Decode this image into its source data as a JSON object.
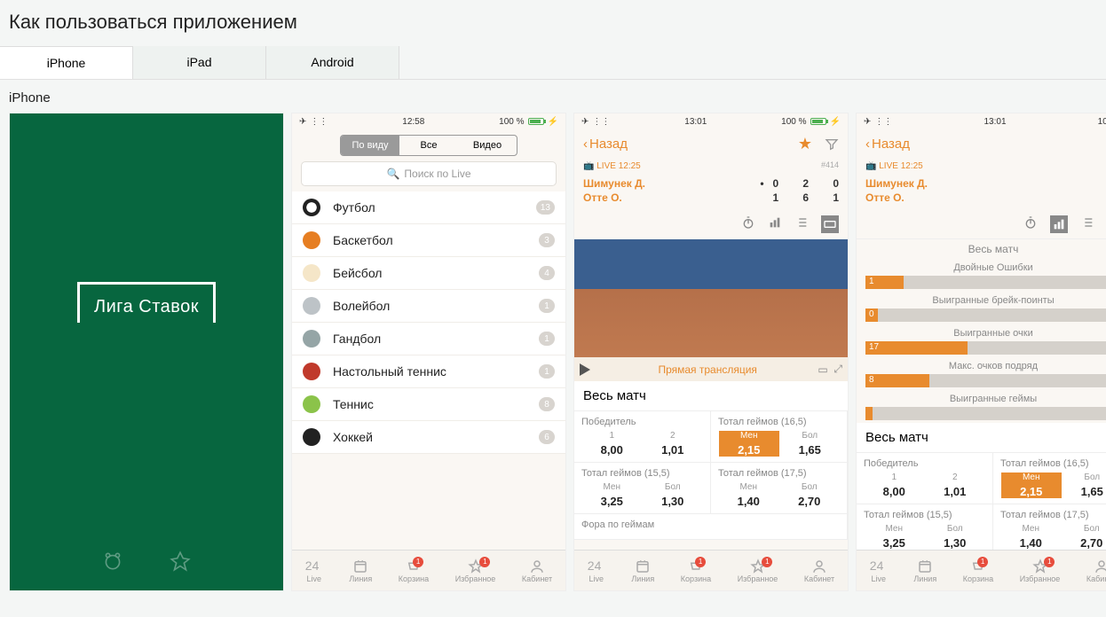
{
  "page": {
    "title": "Как пользоваться приложением",
    "sub": "iPhone"
  },
  "tabs": [
    {
      "label": "iPhone"
    },
    {
      "label": "iPad"
    },
    {
      "label": "Android"
    }
  ],
  "shot1": {
    "logo": "Лига Ставок"
  },
  "sbar": {
    "time2": "12:58",
    "time3": "13:01",
    "time4": "13:01",
    "batt": "100 %"
  },
  "seg": {
    "a": "По виду",
    "b": "Все",
    "c": "Видео"
  },
  "search": {
    "placeholder": "Поиск по Live"
  },
  "sports": [
    {
      "name": "Футбол",
      "count": "13",
      "color": "#222",
      "bg": "radial-gradient(circle,#fff 40%,#222 42%)"
    },
    {
      "name": "Баскетбол",
      "count": "3",
      "bg": "#e67e22"
    },
    {
      "name": "Бейсбол",
      "count": "4",
      "bg": "#f5e6c8"
    },
    {
      "name": "Волейбол",
      "count": "1",
      "bg": "#bdc3c7"
    },
    {
      "name": "Гандбол",
      "count": "1",
      "bg": "#95a5a6"
    },
    {
      "name": "Настольный теннис",
      "count": "1",
      "bg": "#c0392b"
    },
    {
      "name": "Теннис",
      "count": "8",
      "bg": "#8bc34a"
    },
    {
      "name": "Хоккей",
      "count": "6",
      "bg": "#222"
    }
  ],
  "bottom": [
    {
      "label": "Live",
      "glyph": "24"
    },
    {
      "label": "Линия"
    },
    {
      "label": "Корзина",
      "badge": "1"
    },
    {
      "label": "Избранное",
      "badge": "1"
    },
    {
      "label": "Кабинет"
    }
  ],
  "nav": {
    "back": "Назад"
  },
  "match": {
    "live": "LIVE 12:25",
    "id": "#414",
    "p1": {
      "name": "Шимунек Д.",
      "s1": "0",
      "s2": "2",
      "s3": "0",
      "serve": "•"
    },
    "p2": {
      "name": "Отте О.",
      "s1": "1",
      "s2": "6",
      "s3": "1"
    }
  },
  "video": {
    "label": "Прямая трансляция"
  },
  "section": "Весь матч",
  "markets": {
    "winner": {
      "title": "Победитель",
      "o1": {
        "lb": "1",
        "vl": "8,00"
      },
      "o2": {
        "lb": "2",
        "vl": "1,01"
      }
    },
    "tot165": {
      "title": "Тотал геймов (16,5)",
      "o1": {
        "lb": "Мен",
        "vl": "2,15"
      },
      "o2": {
        "lb": "Бол",
        "vl": "1,65"
      }
    },
    "tot155": {
      "title": "Тотал геймов (15,5)",
      "o1": {
        "lb": "Мен",
        "vl": "3,25"
      },
      "o2": {
        "lb": "Бол",
        "vl": "1,30"
      }
    },
    "tot175": {
      "title": "Тотал геймов (17,5)",
      "o1": {
        "lb": "Мен",
        "vl": "1,40"
      },
      "o2": {
        "lb": "Бол",
        "vl": "2,70"
      }
    },
    "fora": {
      "title": "Фора по геймам"
    }
  },
  "stats": {
    "title": "Весь матч",
    "rows": [
      {
        "label": "Двойные Ошибки",
        "v": "1",
        "w": "15%"
      },
      {
        "label": "Выигранные брейк-поинты",
        "v": "0",
        "w": "5%"
      },
      {
        "label": "Выигранные очки",
        "v": "17",
        "w": "40%"
      },
      {
        "label": "Макс. очков подряд",
        "v": "8",
        "w": "25%"
      },
      {
        "label": "Выигранные геймы",
        "v": "",
        "w": "0%"
      }
    ]
  }
}
